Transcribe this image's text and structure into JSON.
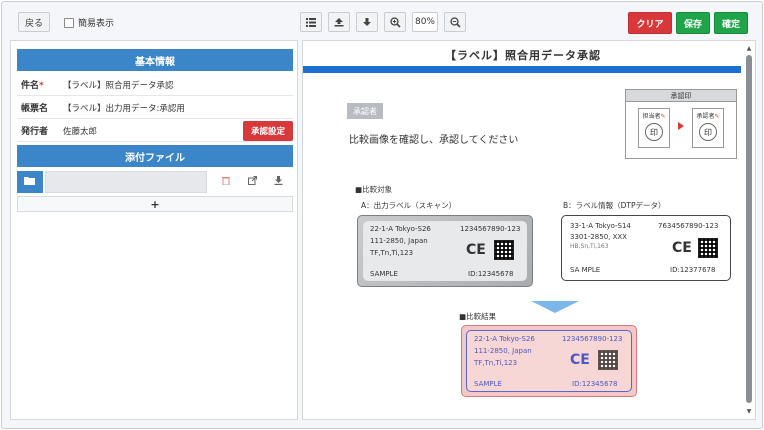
{
  "toolbar": {
    "back_label": "戻る",
    "simple_view_label": "簡易表示",
    "zoom_value": "80%",
    "clear_label": "クリア",
    "save_label": "保存",
    "confirm_label": "確定"
  },
  "left": {
    "basic_info_title": "基本情報",
    "fields": [
      {
        "label": "件名",
        "required_mark": "*",
        "value": "【ラベル】照合用データ承認"
      },
      {
        "label": "帳票名",
        "value": "【ラベル】出力用データ:承認用"
      },
      {
        "label": "発行者",
        "value": "佐藤太郎"
      }
    ],
    "approval_setting_label": "承認設定",
    "attachments_title": "添付ファイル",
    "add_symbol": "+"
  },
  "document": {
    "title": "【ラベル】照合用データ承認",
    "approver_tag": "承認者",
    "instruction": "比較画像を確認し、承認してください",
    "stamp_box": {
      "header": "承認印",
      "person_in_charge": "担当者",
      "approver": "承認者",
      "seal_char": "印"
    },
    "compare_heading": "■比較対象",
    "label_a_caption": "A：出力ラベル（スキャン）",
    "label_b_caption": "B：ラベル情報（DTPデータ）",
    "result_heading": "■比較結果",
    "label_a": {
      "line1": "22-1-A Tokyo-S26",
      "line2": "111-2850, Japan",
      "line3": "TF,Tn,Ti,123",
      "code": "1234567890-123",
      "ce": "CE",
      "sample": "SAMPLE",
      "id": "ID:12345678"
    },
    "label_b": {
      "line1": "33-1-A Tokyo-S14",
      "line2": "3301-2850, XXX",
      "line3": "HB,Sn,Ti,163",
      "code": "7634567890-123",
      "ce": "CE",
      "sample": "SA MPLE",
      "id": "ID:12377678"
    },
    "label_c": {
      "line1": "22-1-A Tokyo-S26",
      "line2": "111-2850, Japan",
      "line3": "TF,Tn,Ti,123",
      "code": "1234567890-123",
      "ce": "CE",
      "sample": "SAMPLE",
      "id": "ID:12345678"
    }
  },
  "colors": {
    "accent_blue": "#3a86c8",
    "title_bar": "#1c6fd1",
    "danger_red": "#d9383a",
    "success_green": "#1fa44a"
  }
}
